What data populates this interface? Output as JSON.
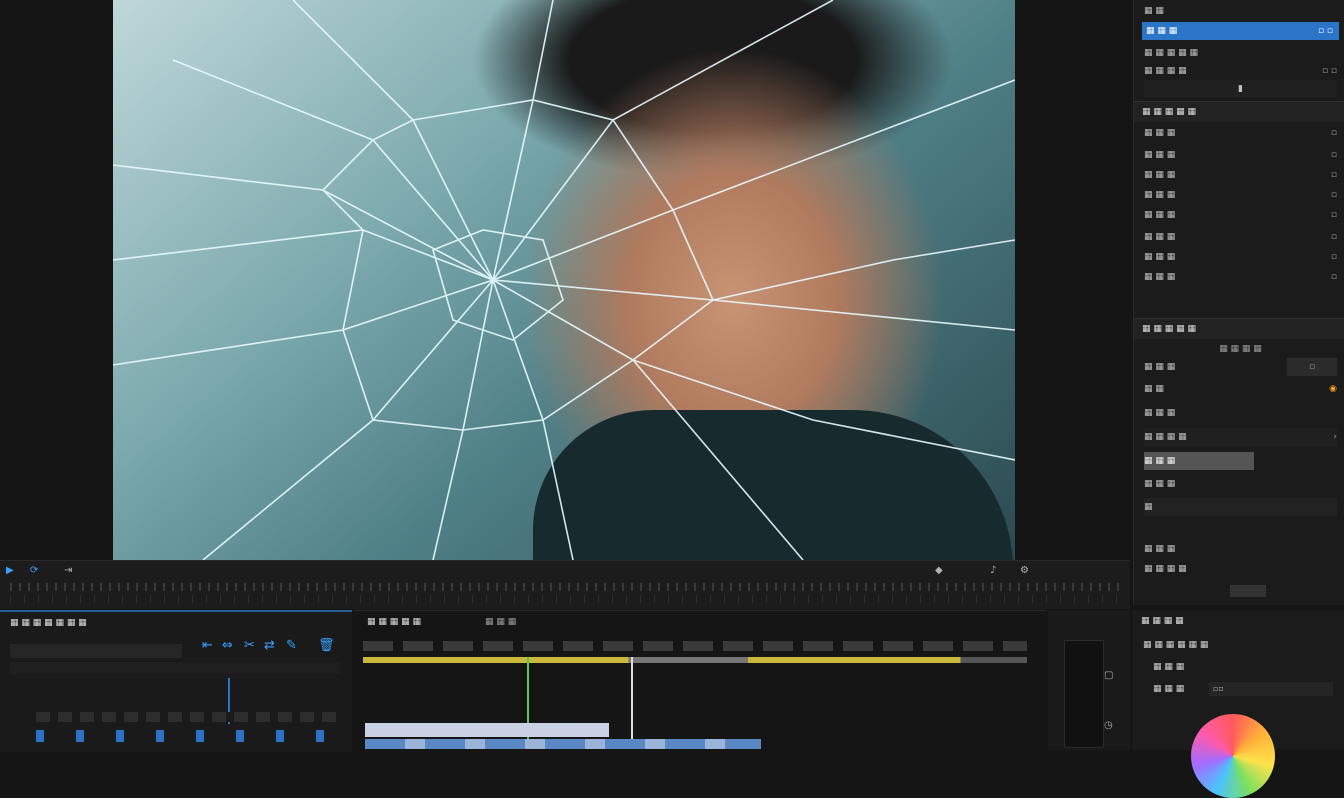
{
  "viewer": {
    "subject": "cracked-glass portrait"
  },
  "right_panel": {
    "top_items": [
      {
        "label": "▦ ▦",
        "value": ""
      },
      {
        "label": "▦ ▦ ▦",
        "value": "▫ ▫",
        "selected": true
      },
      {
        "label": "▦ ▦ ▦ ▦ ▦",
        "value": ""
      },
      {
        "label": "▦ ▦ ▦ ▦",
        "value": "▫ ▫"
      },
      {
        "label": "▮",
        "value": "▫"
      }
    ],
    "section1": {
      "title": "▦ ▦ ▦ ▦ ▦",
      "rows": [
        "▦ ▦ ▦",
        "▦ ▦ ▦",
        "▦ ▦ ▦",
        "▦ ▦ ▦",
        "▦ ▦ ▦",
        "▦ ▦ ▦",
        "▦ ▦ ▦",
        "▦ ▦ ▦"
      ],
      "values": [
        "▫",
        "▫",
        "▫",
        "▫",
        "▫",
        "▫",
        "▫",
        "▫"
      ]
    },
    "section2": {
      "title": "▦ ▦ ▦ ▦ ▦",
      "subtitle": "▦ ▦ ▦ ▦",
      "rows": [
        "▦ ▦ ▦",
        "▦ ▦",
        "▦ ▦ ▦",
        "▦ ▦ ▦ ▦",
        "▦ ▦ ▦",
        "▦ ▦ ▦",
        "▦",
        "▦ ▦ ▦",
        "▦ ▦ ▦ ▦"
      ],
      "selected_index": 4
    }
  },
  "transport": {
    "left_icons": [
      "play-icon",
      "loop-icon"
    ],
    "right_icons": [
      "marker-icon",
      "audio-icon",
      "settings-icon"
    ]
  },
  "left_bottom": {
    "title": "▦ ▦ ▦ ▦ ▦ ▦ ▦",
    "tool_icons": [
      "ripple-icon",
      "trim-icon",
      "razor-icon",
      "slip-icon",
      "pen-icon",
      "delete-icon"
    ]
  },
  "timeline": {
    "tabs": [
      "▦ ▦ ▦ ▦ ▦",
      "▦ ▦ ▦"
    ],
    "playhead_color": "#4ecb5a",
    "work_area_color": "#c9b83a"
  },
  "color_panel": {
    "title": "▦ ▦ ▦ ▦",
    "rows": [
      "▦ ▦ ▦ ▦ ▦ ▦",
      "▦ ▦ ▦",
      "▦ ▦ ▦"
    ],
    "value": "▫▫"
  },
  "colors": {
    "accent": "#2a75c8",
    "panel_bg": "#1b1b1b"
  }
}
